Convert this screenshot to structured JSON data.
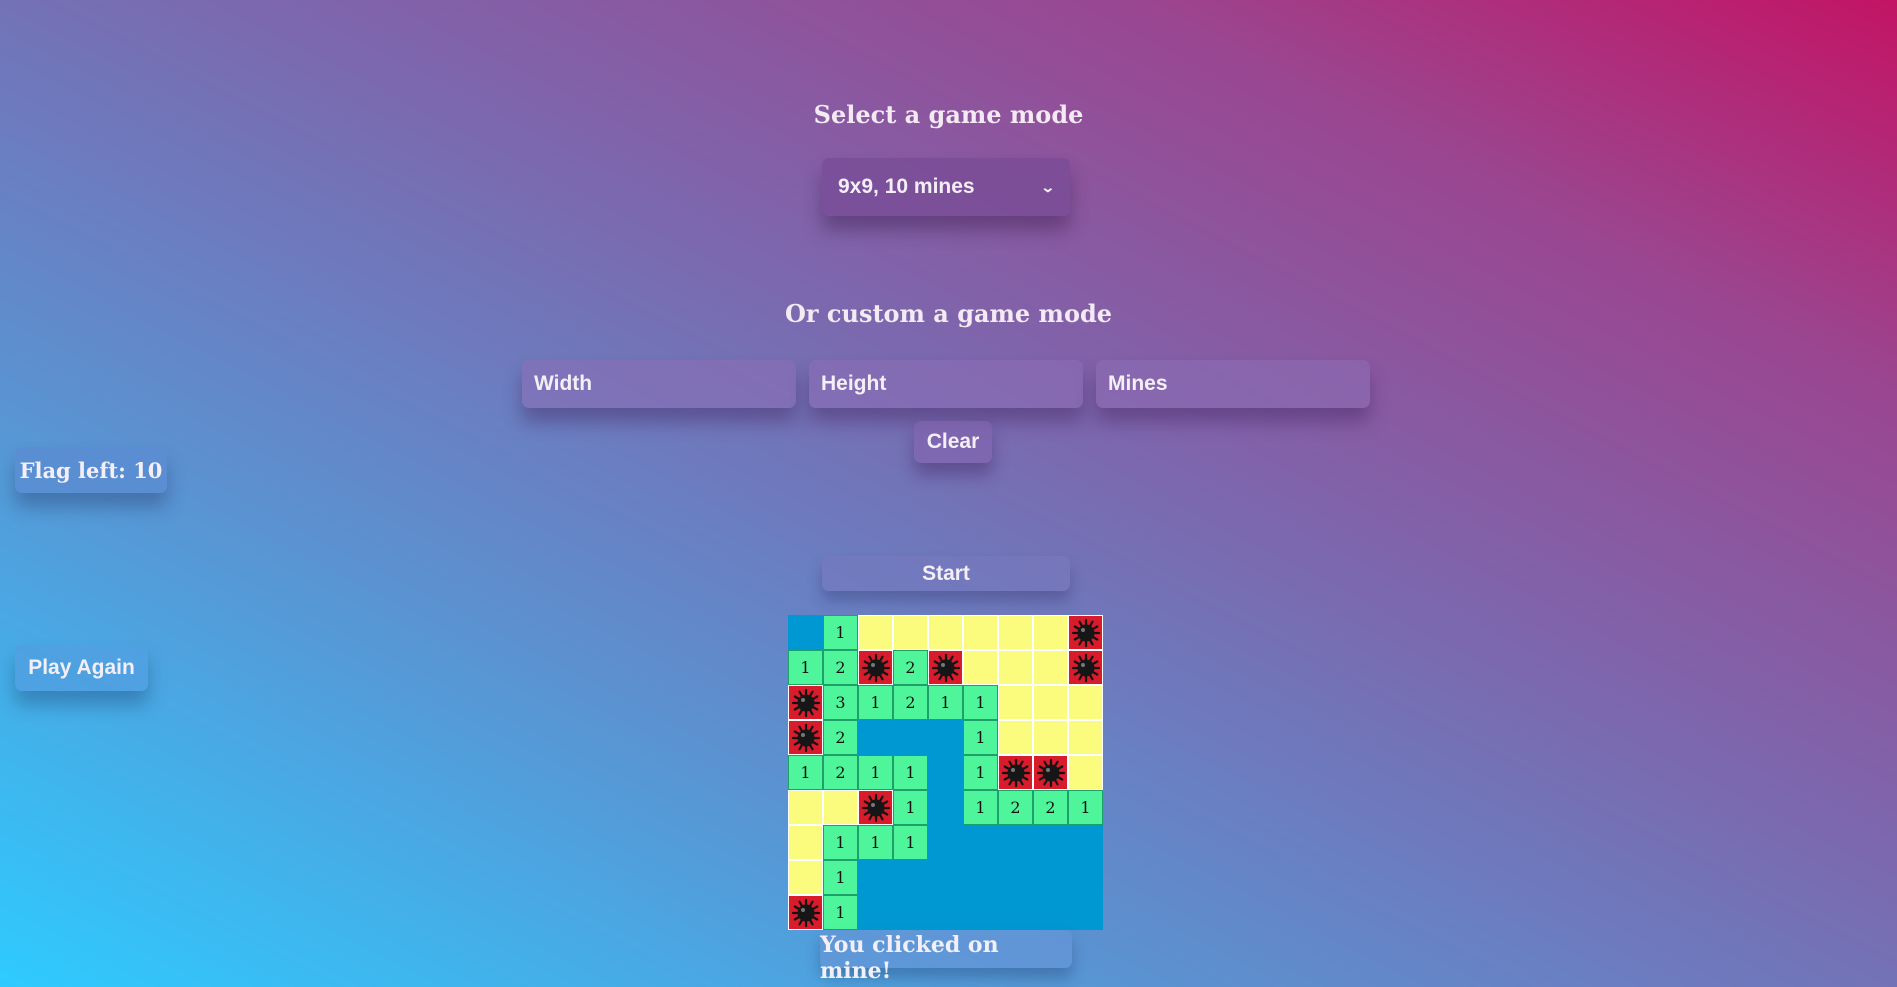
{
  "mode_section": {
    "title": "Select a game mode",
    "selected_mode": "9x9, 10 mines",
    "dropdown_icon": "chevron-down-icon"
  },
  "custom_section": {
    "title": "Or custom a game mode",
    "width_placeholder": "Width",
    "height_placeholder": "Height",
    "mines_placeholder": "Mines",
    "clear_label": "Clear"
  },
  "flags_label": "Flag left: 10",
  "start_label": "Start",
  "play_again_label": "Play Again",
  "status_message": "You clicked on mine!",
  "board": {
    "size": "9x9",
    "legend": {
      "b": "revealed-blank",
      "u": "unrevealed",
      "m": "mine",
      "number": "revealed-count"
    },
    "rows": [
      [
        "b",
        "1",
        "u",
        "u",
        "u",
        "u",
        "u",
        "u",
        "m"
      ],
      [
        "1",
        "2",
        "m",
        "2",
        "m",
        "u",
        "u",
        "u",
        "m"
      ],
      [
        "m",
        "3",
        "1",
        "2",
        "1",
        "1",
        "u",
        "u",
        "u"
      ],
      [
        "m",
        "2",
        "b",
        "b",
        "b",
        "1",
        "u",
        "u",
        "u"
      ],
      [
        "1",
        "2",
        "1",
        "1",
        "b",
        "1",
        "m",
        "m",
        "u"
      ],
      [
        "u",
        "u",
        "m",
        "1",
        "b",
        "1",
        "2",
        "2",
        "1"
      ],
      [
        "u",
        "1",
        "1",
        "1",
        "b",
        "b",
        "b",
        "b",
        "b"
      ],
      [
        "u",
        "1",
        "b",
        "b",
        "b",
        "b",
        "b",
        "b",
        "b"
      ],
      [
        "m",
        "1",
        "b",
        "b",
        "b",
        "b",
        "b",
        "b",
        "b"
      ]
    ]
  },
  "colors": {
    "revealed_number": "#4ff59b",
    "unrevealed": "#fbfb7e",
    "revealed_blank": "#0098d2",
    "mine_background": "#d81c2b"
  }
}
